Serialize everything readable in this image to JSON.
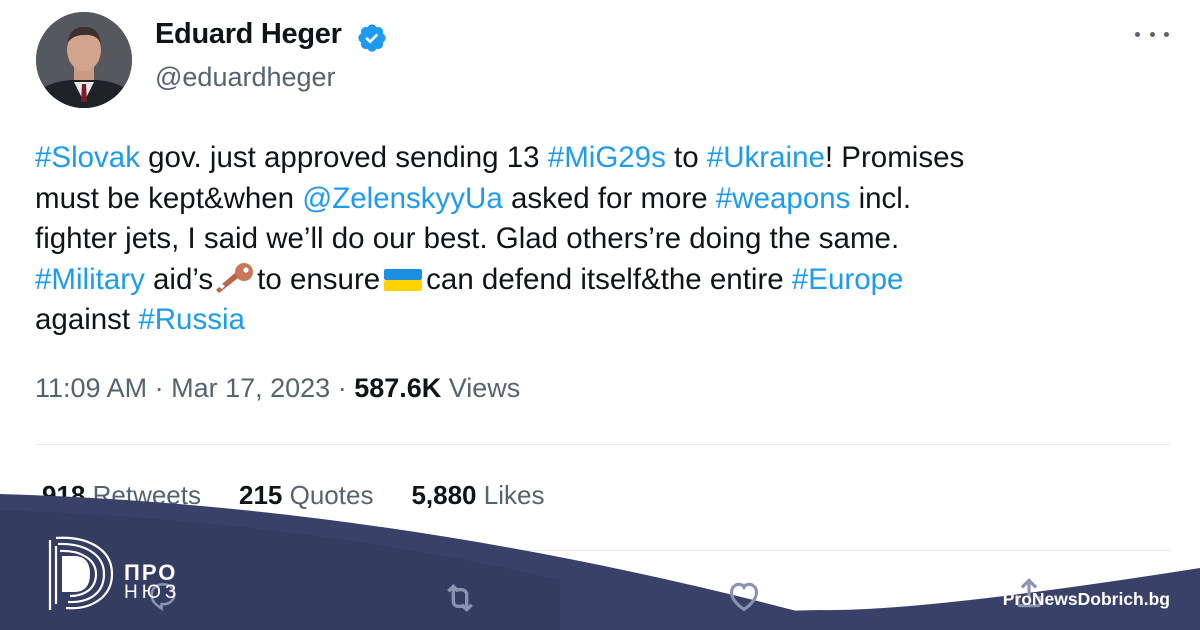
{
  "author": {
    "name": "Eduard Heger",
    "handle": "@eduardheger",
    "verified": true
  },
  "tweet": {
    "lines": [
      [
        {
          "t": "#Slovak",
          "tag": true
        },
        {
          "t": " gov. just approved sending 13 "
        },
        {
          "t": "#MiG29s",
          "tag": true
        },
        {
          "t": " to "
        },
        {
          "t": "#Ukraine",
          "tag": true
        },
        {
          "t": "! Promises"
        }
      ],
      [
        {
          "t": "must be kept&when "
        },
        {
          "t": "@ZelenskyyUa",
          "tag": true
        },
        {
          "t": " asked for more "
        },
        {
          "t": "#weapons",
          "tag": true
        },
        {
          "t": " incl."
        }
      ],
      [
        {
          "t": "fighter jets, I said we’ll do our best. Glad others’re doing the same."
        }
      ],
      [
        {
          "t": "#Military",
          "tag": true
        },
        {
          "t": " aid’s"
        },
        {
          "emoji": "key"
        },
        {
          "t": "to ensure"
        },
        {
          "emoji": "ukraine-flag"
        },
        {
          "t": "can defend itself&the entire "
        },
        {
          "t": "#Europe",
          "tag": true
        }
      ],
      [
        {
          "t": "against "
        },
        {
          "t": "#Russia",
          "tag": true
        }
      ]
    ]
  },
  "meta": {
    "time": "11:09 AM",
    "separator": " · ",
    "date": "Mar 17, 2023",
    "views_count": "587.6K",
    "views_label": " Views"
  },
  "stats": {
    "retweets_count": "918",
    "retweets_label": " Retweets",
    "quotes_count": "215",
    "quotes_label": " Quotes",
    "likes_count": "5,880",
    "likes_label": " Likes"
  },
  "actions": {
    "icons": [
      "reply-icon",
      "retweet-icon",
      "like-icon",
      "share-icon"
    ]
  },
  "branding": {
    "logo_line1": "ПРО",
    "logo_line2": "НЮЗ",
    "site": "ProNewsDobrich.bg"
  },
  "colors": {
    "hashtag": "#1d9bf0",
    "secondary_text": "#536471",
    "verified_badge": "#1d9bf0",
    "banner": "#3a4168",
    "banner_dark": "#2f3557"
  }
}
